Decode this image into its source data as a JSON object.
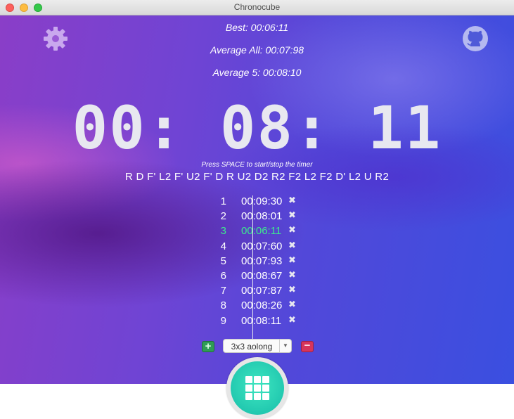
{
  "window": {
    "title": "Chronocube"
  },
  "stats": {
    "best": "Best: 00:06:11",
    "average_all": "Average All: 00:07:98",
    "average_5": "Average 5: 00:08:10"
  },
  "timer": {
    "display": "00: 08: 11"
  },
  "hint": "Press SPACE to start/stop the timer",
  "scramble": "R D F' L2 F' U2 F' D R U2 D2 R2 F2 L2 F2 D' L2 U R2",
  "solves": [
    {
      "num": "1",
      "time": "00:09:30",
      "delete": "✖"
    },
    {
      "num": "2",
      "time": "00:08:01",
      "delete": "✖"
    },
    {
      "num": "3",
      "time": "00:06:11",
      "delete": "✖"
    },
    {
      "num": "4",
      "time": "00:07:60",
      "delete": "✖"
    },
    {
      "num": "5",
      "time": "00:07:93",
      "delete": "✖"
    },
    {
      "num": "6",
      "time": "00:08:67",
      "delete": "✖"
    },
    {
      "num": "7",
      "time": "00:07:87",
      "delete": "✖"
    },
    {
      "num": "8",
      "time": "00:08:26",
      "delete": "✖"
    },
    {
      "num": "9",
      "time": "00:08:11",
      "delete": "✖"
    }
  ],
  "controls": {
    "add_label": "+",
    "remove_label": "−",
    "session_select": "3x3 aolong"
  },
  "icons": {
    "settings": "gear-icon",
    "repo": "github-icon",
    "cube": "cube-icon"
  },
  "colors": {
    "best_time": "#3dea8e",
    "add": "#2f9b55",
    "remove": "#d6345c",
    "cube_button": "#22c9b0"
  }
}
